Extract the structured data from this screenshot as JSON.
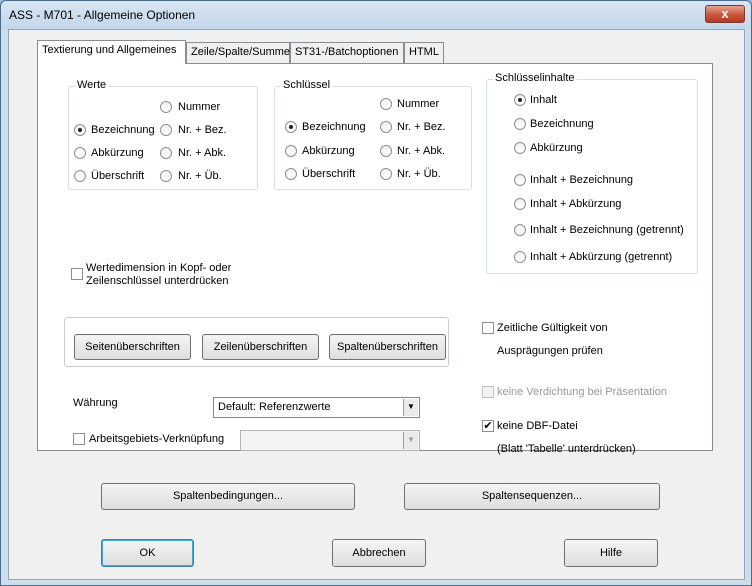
{
  "window": {
    "title": "ASS - M701 - Allgemeine Optionen",
    "close_glyph": "x"
  },
  "tabs": [
    {
      "label": "Textierung und Allgemeines",
      "active": true
    },
    {
      "label": "Zeile/Spalte/Summe",
      "active": false
    },
    {
      "label": "ST31-/Batchoptionen",
      "active": false
    },
    {
      "label": "HTML",
      "active": false
    }
  ],
  "werte": {
    "title": "Werte",
    "options": [
      {
        "label": "Nummer",
        "selected": false
      },
      {
        "label": "Bezeichnung",
        "selected": true
      },
      {
        "label": "Nr. + Bez.",
        "selected": false
      },
      {
        "label": "Abkürzung",
        "selected": false
      },
      {
        "label": "Nr. + Abk.",
        "selected": false
      },
      {
        "label": "Überschrift",
        "selected": false
      },
      {
        "label": "Nr. + Üb.",
        "selected": false
      }
    ]
  },
  "schluessel": {
    "title": "Schlüssel",
    "options": [
      {
        "label": "Nummer",
        "selected": false
      },
      {
        "label": "Bezeichnung",
        "selected": true
      },
      {
        "label": "Nr. + Bez.",
        "selected": false
      },
      {
        "label": "Abkürzung",
        "selected": false
      },
      {
        "label": "Nr. + Abk.",
        "selected": false
      },
      {
        "label": "Überschrift",
        "selected": false
      },
      {
        "label": "Nr. + Üb.",
        "selected": false
      }
    ]
  },
  "schluesselinhalte": {
    "title": "Schlüsselinhalte",
    "options": [
      {
        "label": "Inhalt",
        "selected": true
      },
      {
        "label": "Bezeichnung",
        "selected": false
      },
      {
        "label": "Abkürzung",
        "selected": false
      },
      {
        "label": "Inhalt + Bezeichnung",
        "selected": false
      },
      {
        "label": "Inhalt + Abkürzung",
        "selected": false
      },
      {
        "label": "Inhalt + Bezeichnung (getrennt)",
        "selected": false
      },
      {
        "label": "Inhalt + Abkürzung (getrennt)",
        "selected": false
      }
    ]
  },
  "wertedimension": {
    "line1": "Wertedimension in Kopf- oder",
    "line2": "Zeilenschlüssel unterdrücken",
    "checked": false
  },
  "heading_buttons": {
    "seiten": "Seitenüberschriften",
    "zeilen": "Zeilenüberschriften",
    "spalten": "Spaltenüberschriften"
  },
  "zeitliche": {
    "line1": "Zeitliche Gültigkeit von",
    "line2": "Ausprägungen prüfen",
    "checked": false
  },
  "verdichtung": {
    "label": "keine Verdichtung bei Präsentation",
    "checked": false,
    "enabled": false
  },
  "dbf": {
    "label": "keine DBF-Datei",
    "note": "(Blatt 'Tabelle' unterdrücken)",
    "checked": true,
    "check_glyph": "✔"
  },
  "waehrung": {
    "label": "Währung",
    "value": "Default: Referenzwerte"
  },
  "arbeitsgebiet": {
    "label": "Arbeitsgebiets-Verknüpfung",
    "checked": false,
    "value": ""
  },
  "dropdown_glyph": "▼",
  "buttons": {
    "spaltenbedingungen": "Spaltenbedingungen...",
    "spaltensequenzen": "Spaltensequenzen...",
    "ok": "OK",
    "abbrechen": "Abbrechen",
    "hilfe": "Hilfe"
  }
}
